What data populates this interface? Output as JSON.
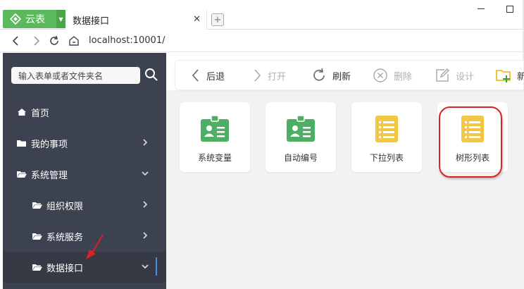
{
  "browser": {
    "app_name": "云表",
    "tab_title": "数据接口",
    "url": "localhost:10001/"
  },
  "sidebar": {
    "search_placeholder": "输入表单或者文件夹名",
    "items": [
      {
        "label": "首页",
        "icon": "home-icon"
      },
      {
        "label": "我的事项",
        "icon": "folder-icon",
        "chevron": "right"
      },
      {
        "label": "系统管理",
        "icon": "folder-icon",
        "chevron": "down"
      },
      {
        "label": "组织权限",
        "icon": "folder-icon",
        "chevron": "right"
      },
      {
        "label": "系统服务",
        "icon": "folder-icon",
        "chevron": "right"
      },
      {
        "label": "数据接口",
        "icon": "folder-icon",
        "chevron": "down",
        "active": true
      }
    ]
  },
  "toolbar": {
    "back": "后退",
    "open": "打开",
    "refresh": "刷新",
    "delete": "删除",
    "design": "设计",
    "new": "新"
  },
  "cards": [
    {
      "label": "系统变量",
      "icon": "green-id-card-icon"
    },
    {
      "label": "自动编号",
      "icon": "green-id-card-icon"
    },
    {
      "label": "下拉列表",
      "icon": "yellow-document-icon"
    },
    {
      "label": "树形列表",
      "icon": "yellow-document-icon"
    }
  ],
  "colors": {
    "sidebar_bg": "#3d4250",
    "brand_green": "#5cb85c",
    "card_green": "#4caf64",
    "card_yellow": "#f2c744",
    "highlight_red": "#e02020",
    "active_indicator": "#4a90e2"
  }
}
